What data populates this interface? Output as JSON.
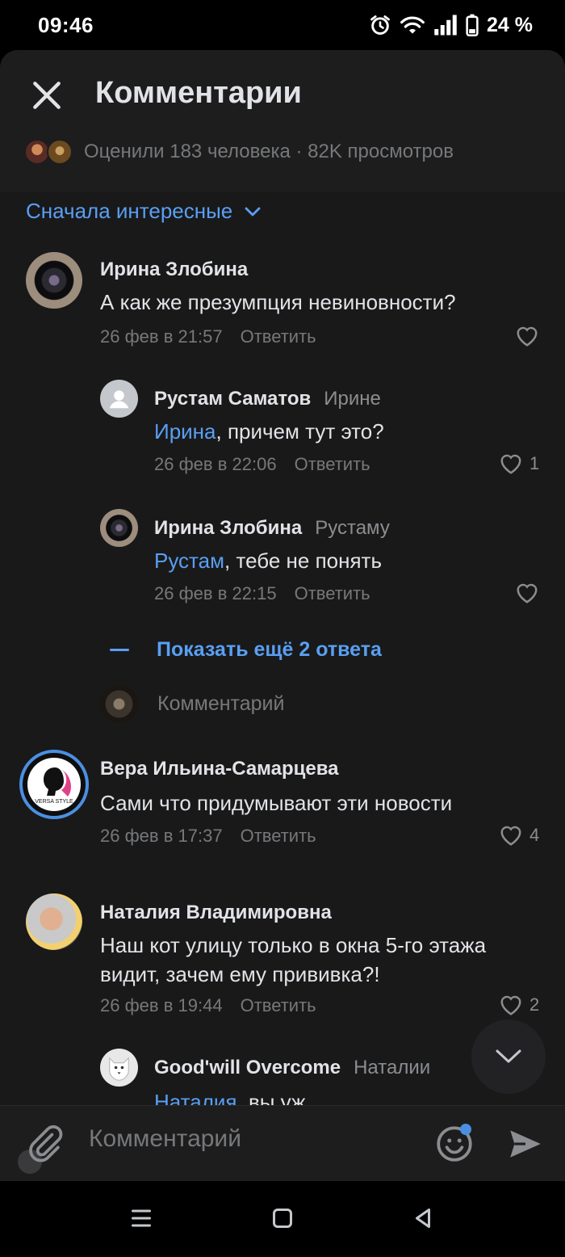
{
  "status_bar": {
    "time": "09:46",
    "battery": "24 %",
    "icons": [
      "alarm-icon",
      "wifi-icon",
      "signal-icon",
      "battery-icon"
    ]
  },
  "header": {
    "title": "Комментарии",
    "likers_text": "Оценили 183 человека · 82K просмотров"
  },
  "sort": {
    "label": "Сначала интересные"
  },
  "comments": [
    {
      "author": "Ирина Злобина",
      "text": "А как же презумпция невиновности?",
      "date": "26 фев в 21:57",
      "reply": "Ответить",
      "likes": ""
    },
    {
      "author": "Рустам Саматов",
      "reply_to": "Ирине",
      "mention": "Ирина",
      "text": ", причем тут это?",
      "date": "26 фев в 22:06",
      "reply": "Ответить",
      "likes": "1"
    },
    {
      "author": "Ирина Злобина",
      "reply_to": "Рустаму",
      "mention": "Рустам",
      "text": ", тебе не понять",
      "date": "26 фев в 22:15",
      "reply": "Ответить",
      "likes": ""
    },
    {
      "author": "Вера Ильина-Самарцева",
      "text": "Сами что придумывают эти новости",
      "date": "26 фев в 17:37",
      "reply": "Ответить",
      "likes": "4"
    },
    {
      "author": "Наталия Владимировна",
      "text_line1": "Наш кот улицу только в окна 5-го этажа",
      "text_line2": "видит, зачем ему прививка?!",
      "date": "26 фев в 19:44",
      "reply": "Ответить",
      "likes": "2"
    },
    {
      "author": "Good'will Overcome",
      "reply_to": "Наталии",
      "mention": "Наталия",
      "text": ", вы уж"
    }
  ],
  "thread": {
    "show_more": "Показать ещё 2 ответа",
    "reply_placeholder": "Комментарий"
  },
  "avatar_text": {
    "vera_brand": "VERSA STYLE"
  },
  "composer": {
    "placeholder": "Комментарий"
  },
  "colors": {
    "accent": "#5a9ff2",
    "background": "#19191a",
    "text_primary": "#e1e3e6",
    "text_secondary": "#76787a"
  }
}
